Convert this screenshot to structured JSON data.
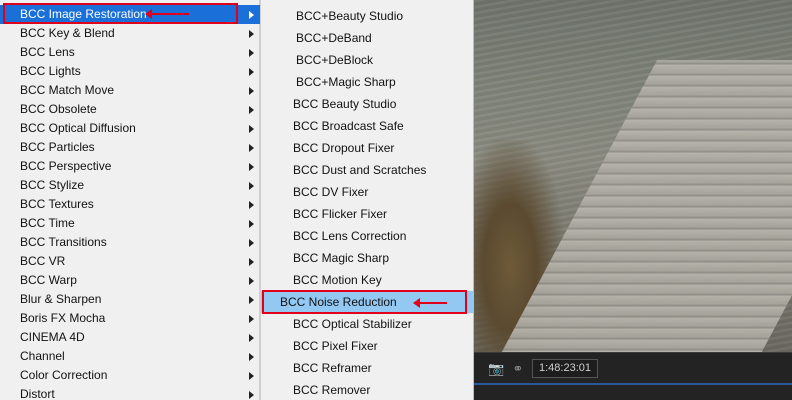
{
  "left_menu": {
    "items": [
      {
        "label": "BCC Image Restoration",
        "selected": true,
        "has_submenu": true
      },
      {
        "label": "BCC Key & Blend",
        "has_submenu": true
      },
      {
        "label": "BCC Lens",
        "has_submenu": true
      },
      {
        "label": "BCC Lights",
        "has_submenu": true
      },
      {
        "label": "BCC Match Move",
        "has_submenu": true
      },
      {
        "label": "BCC Obsolete",
        "has_submenu": true
      },
      {
        "label": "BCC Optical Diffusion",
        "has_submenu": true
      },
      {
        "label": "BCC Particles",
        "has_submenu": true
      },
      {
        "label": "BCC Perspective",
        "has_submenu": true
      },
      {
        "label": "BCC Stylize",
        "has_submenu": true
      },
      {
        "label": "BCC Textures",
        "has_submenu": true
      },
      {
        "label": "BCC Time",
        "has_submenu": true
      },
      {
        "label": "BCC Transitions",
        "has_submenu": true
      },
      {
        "label": "BCC VR",
        "has_submenu": true
      },
      {
        "label": "BCC Warp",
        "has_submenu": true
      },
      {
        "label": "Blur & Sharpen",
        "has_submenu": true
      },
      {
        "label": "Boris FX Mocha",
        "has_submenu": true
      },
      {
        "label": "CINEMA 4D",
        "has_submenu": true
      },
      {
        "label": "Channel",
        "has_submenu": true
      },
      {
        "label": "Color Correction",
        "has_submenu": true
      },
      {
        "label": "Distort",
        "has_submenu": true
      }
    ]
  },
  "submenu": {
    "items": [
      {
        "label": "BCC+Beauty Studio"
      },
      {
        "label": "BCC+DeBand"
      },
      {
        "label": "BCC+DeBlock"
      },
      {
        "label": "BCC+Magic Sharp"
      },
      {
        "label": "BCC Beauty Studio"
      },
      {
        "label": "BCC Broadcast Safe"
      },
      {
        "label": "BCC Dropout Fixer"
      },
      {
        "label": "BCC Dust and Scratches"
      },
      {
        "label": "BCC DV Fixer"
      },
      {
        "label": "BCC Flicker Fixer"
      },
      {
        "label": "BCC Lens Correction"
      },
      {
        "label": "BCC Magic Sharp"
      },
      {
        "label": "BCC Motion Key"
      },
      {
        "label": "BCC Noise Reduction",
        "highlighted": true
      },
      {
        "label": "BCC Optical Stabilizer"
      },
      {
        "label": "BCC Pixel Fixer"
      },
      {
        "label": "BCC Reframer"
      },
      {
        "label": "BCC Remover"
      }
    ]
  },
  "timeline": {
    "timecode": "1:48:23:01",
    "camera_icon": "camera-icon",
    "link_icon": "link-icon"
  },
  "colors": {
    "selection_blue": "#1a70d8",
    "highlight_blue": "#93c8f3",
    "annotation_red": "#e0001b",
    "menu_bg": "#f0f0f0"
  }
}
